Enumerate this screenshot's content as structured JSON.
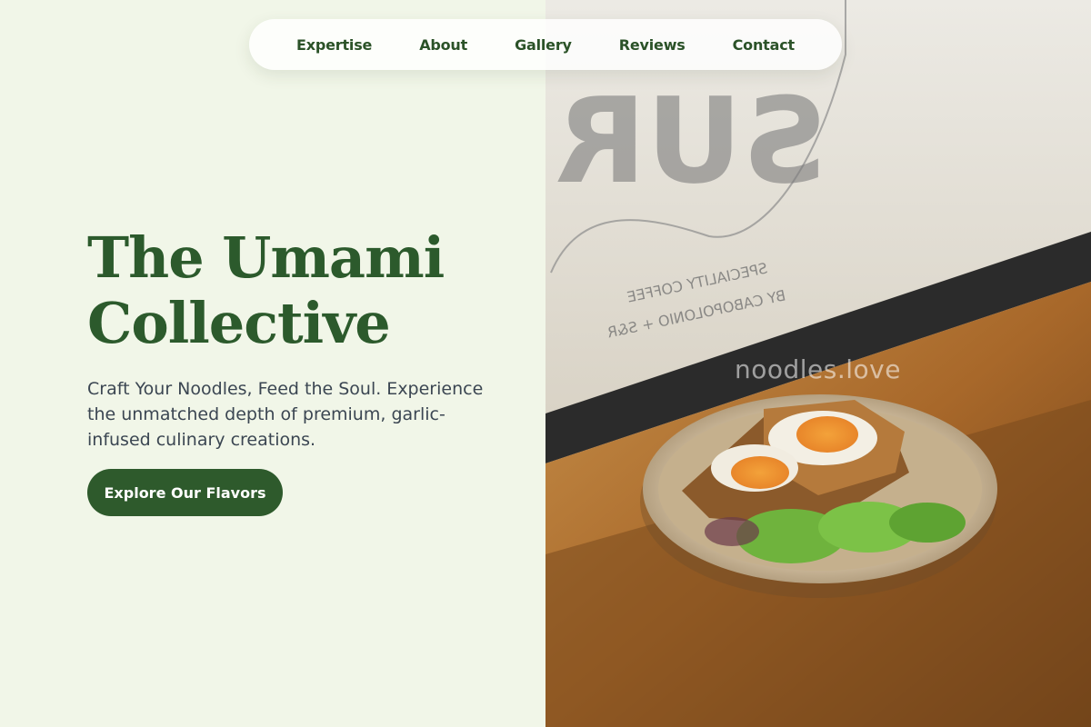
{
  "nav": {
    "items": [
      {
        "label": "Expertise"
      },
      {
        "label": "About"
      },
      {
        "label": "Gallery"
      },
      {
        "label": "Reviews"
      },
      {
        "label": "Contact"
      }
    ]
  },
  "hero": {
    "title_line1": "The Umami",
    "title_line2": "Collective",
    "subtitle": "Craft Your Noodles, Feed the Soul. Experience the unmatched depth of premium, garlic-infused culinary creations.",
    "cta_label": "Explore Our Flavors"
  },
  "photo": {
    "window_text_large": "SUR",
    "window_text_line1": "SPECIALITY COFFEE",
    "window_text_line2": "BY CABOPOLONIO + S&R",
    "watermark": "noodles.love"
  },
  "colors": {
    "background": "#f1f6e8",
    "brand_green": "#2c5a2c",
    "nav_text": "#2b5228",
    "body_text": "#3b4652",
    "cta_bg": "#2e5a2c",
    "cta_text": "#ffffff"
  }
}
